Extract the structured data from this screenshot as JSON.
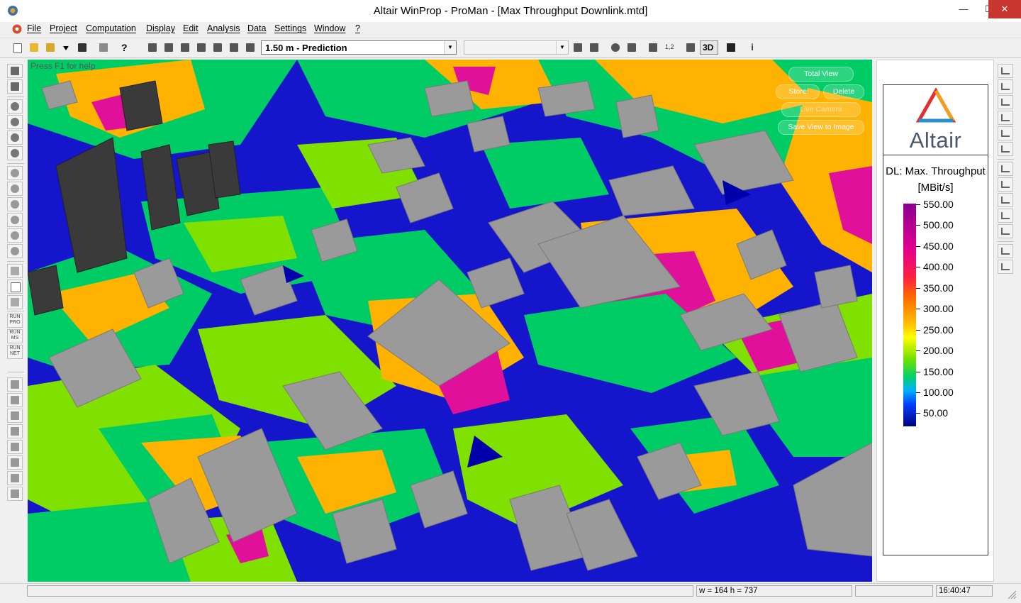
{
  "window": {
    "title": "Altair WinProp - ProMan - [Max Throughput Downlink.mtd]",
    "minimize": "—",
    "maximize": "☐",
    "close": "✕"
  },
  "menu": [
    "File",
    "Project",
    "Computation",
    "Display",
    "Edit",
    "Analysis",
    "Data",
    "Settings",
    "Window",
    "?"
  ],
  "mdi_controls": [
    "–",
    "▫",
    "✕"
  ],
  "toolbar": {
    "prediction_combo": "1.50 m - Prediction",
    "second_combo": "",
    "view_3d_label": "3D"
  },
  "left_tools": {
    "run_labels": [
      "RUN PRO",
      "RUN MS",
      "RUN NET"
    ]
  },
  "viewport": {
    "help_text": "Press F1 for help",
    "buttons": {
      "total_view": "Total View",
      "store": "Store",
      "delete": "Delete",
      "live_camera": "Live Camera",
      "save_view": "Save View to Image"
    }
  },
  "legend": {
    "logo_text": "Altair",
    "title_line1": "DL: Max. Throughput",
    "title_line2": "[MBit/s]",
    "ticks": [
      "550.00",
      "500.00",
      "450.00",
      "400.00",
      "350.00",
      "300.00",
      "250.00",
      "200.00",
      "150.00",
      "100.00",
      "50.00"
    ],
    "scale_colors": [
      "#8a0090",
      "#e00090",
      "#ff2040",
      "#ff6a00",
      "#ffc800",
      "#ffff00",
      "#70e000",
      "#00d070",
      "#00b0ff",
      "#0040ff",
      "#000080"
    ]
  },
  "status": {
    "dimensions": "w = 164 h = 737",
    "time": "16:40:47"
  },
  "map_colors": {
    "low": "#1515cc",
    "mid_low": "#00cc66",
    "mid": "#80e000",
    "mid_high": "#ffb300",
    "high": "#e0109a",
    "building": "#9a9a9a",
    "building_dark": "#3a3a3a"
  }
}
